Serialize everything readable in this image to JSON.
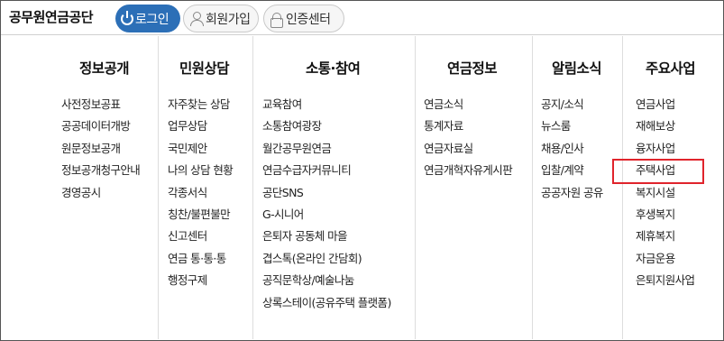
{
  "header": {
    "logo": "공무원연금공단",
    "login_label": "로그인",
    "join_label": "회원가입",
    "cert_label": "인증센터"
  },
  "menu": {
    "columns": [
      {
        "title": "정보공개",
        "items": [
          "사전정보공표",
          "공공데이터개방",
          "원문정보공개",
          "정보공개청구안내",
          "경영공시"
        ]
      },
      {
        "title": "민원상담",
        "items": [
          "자주찾는 상담",
          "업무상담",
          "국민제안",
          "나의 상담 현황",
          "각종서식",
          "칭찬/불편불만",
          "신고센터",
          "연금 통·통·통",
          "행정구제"
        ]
      },
      {
        "title": "소통·참여",
        "items": [
          "교육참여",
          "소통참여광장",
          "월간공무원연금",
          "연금수급자커뮤니티",
          "공단SNS",
          "G-시니어",
          "은퇴자 공동체 마을",
          "겹스톡(온라인 간담회)",
          "공직문학상/예술나눔",
          "상록스테이(공유주택 플랫폼)"
        ]
      },
      {
        "title": "연금정보",
        "items": [
          "연금소식",
          "통계자료",
          "연금자료실",
          "연금개혁자유게시판"
        ]
      },
      {
        "title": "알림소식",
        "items": [
          "공지/소식",
          "뉴스룸",
          "채용/인사",
          "입찰/계약",
          "공공자원 공유"
        ]
      },
      {
        "title": "주요사업",
        "items": [
          "연금사업",
          "재해보상",
          "융자사업",
          "주택사업",
          "복지시설",
          "후생복지",
          "제휴복지",
          "자금운용",
          "은퇴지원사업"
        ],
        "highlighted": "주택사업"
      }
    ]
  },
  "colors": {
    "login_bg": "#2c6fb7",
    "highlight_border": "#e0242c"
  }
}
